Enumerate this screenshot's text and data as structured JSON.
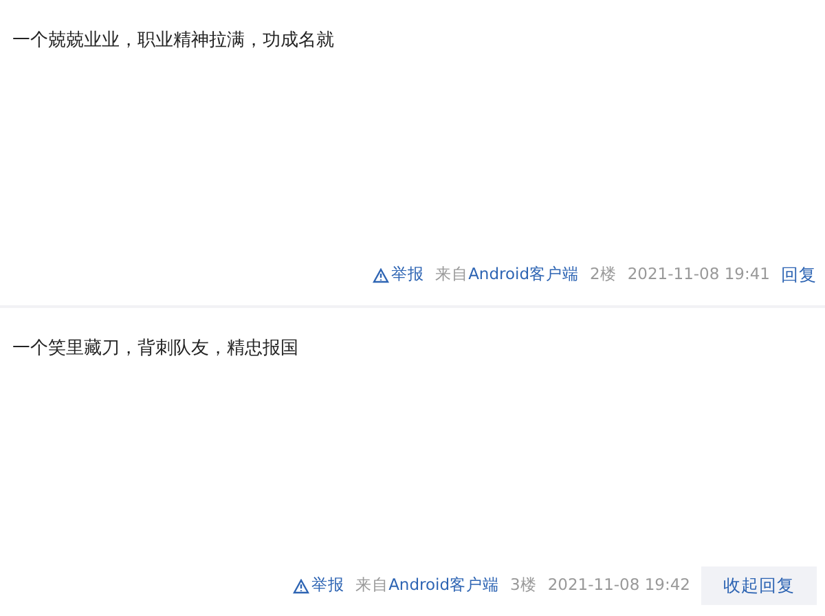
{
  "posts": [
    {
      "content": "一个兢兢业业，职业精神拉满，功成名就",
      "report": "举报",
      "source_prefix": "来自",
      "source": "Android客户端",
      "floor": "2楼",
      "time": "2021-11-08 19:41",
      "reply": {
        "label": "回复",
        "kind": "link"
      }
    },
    {
      "content": "一个笑里藏刀，背刺队友，精忠报国",
      "report": "举报",
      "source_prefix": "来自",
      "source": "Android客户端",
      "floor": "3楼",
      "time": "2021-11-08 19:42",
      "reply": {
        "label": "收起回复",
        "kind": "button"
      }
    }
  ]
}
